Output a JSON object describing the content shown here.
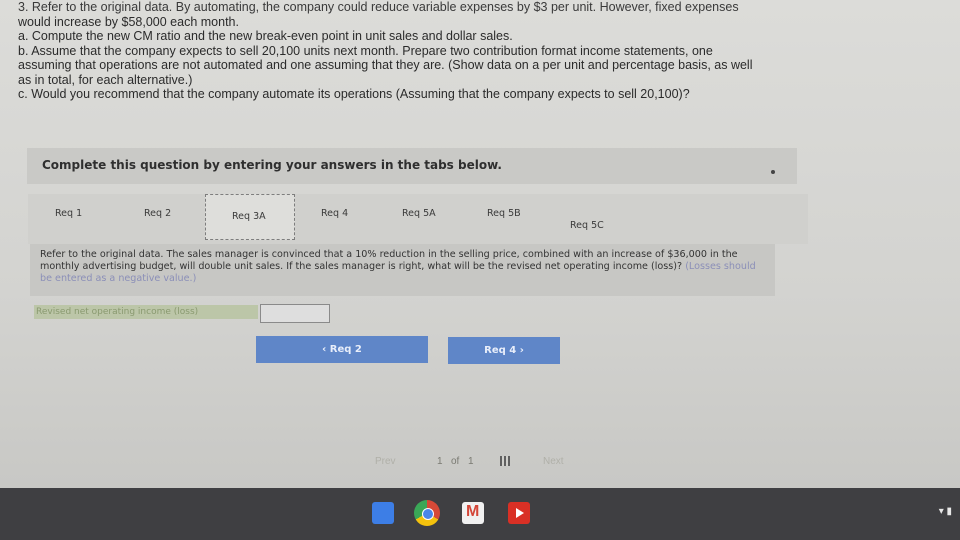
{
  "question": {
    "lines": [
      "3. Refer to the original data. By automating, the company could reduce variable expenses by $3 per unit. However, fixed expenses",
      "would increase by $58,000 each month.",
      "a. Compute the new CM ratio and the new break-even point in unit sales and dollar sales.",
      "b. Assume that the company expects to sell 20,100 units next month. Prepare two contribution format income statements, one",
      "assuming that operations are not automated and one assuming that they are. (Show data on a per unit and percentage basis, as well",
      "as in total, for each alternative.)",
      "c. Would you recommend that the company automate its operations (Assuming that the company  expects to sell 20,100)?"
    ]
  },
  "instructions": "Complete this question by entering your answers in the tabs below.",
  "tabs": [
    {
      "label": "Req 1"
    },
    {
      "label": "Req 2"
    },
    {
      "label": "Req 3A"
    },
    {
      "label": "Req 4"
    },
    {
      "label": "Req 5A"
    },
    {
      "label": "Req 5B"
    },
    {
      "label": "Req 5C"
    }
  ],
  "active_tab": "Req 3A",
  "content": {
    "text": "Refer to the original data. The sales manager is convinced that a 10% reduction in the selling price, combined with an increase of $36,000 in the monthly advertising budget, will double unit sales. If the sales manager is right, what will be the revised net operating income (loss)?",
    "note": "(Losses should be entered as a negative value.)"
  },
  "answer": {
    "label": "Revised net operating income (loss)",
    "value": ""
  },
  "nav": {
    "prev_label": "‹  Req 2",
    "next_label": "Req 4  ›"
  },
  "pager": {
    "prev": "Prev",
    "page": "1",
    "of": "of",
    "total": "1",
    "next": "Next"
  },
  "taskbar": {
    "apps": [
      "docs-icon",
      "chrome-icon",
      "gmail-icon",
      "youtube-icon"
    ],
    "tray": "▾ ▮"
  }
}
